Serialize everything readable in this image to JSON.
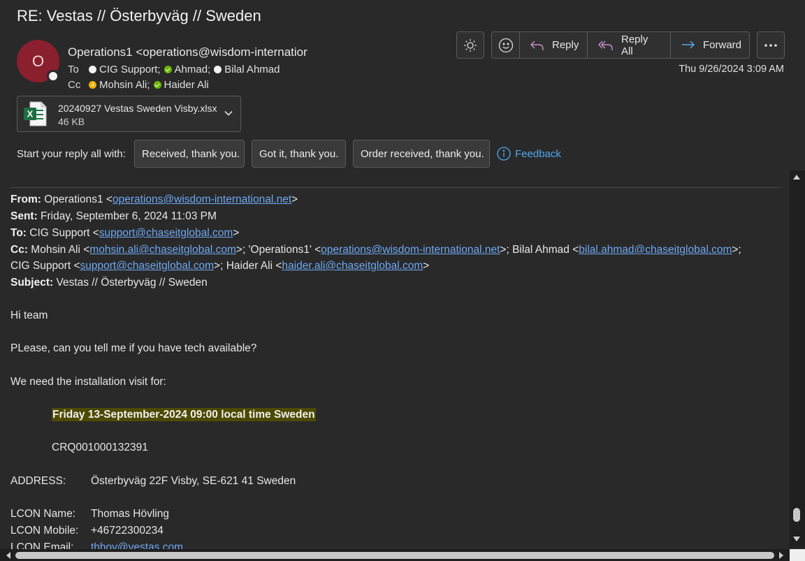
{
  "email": {
    "subject": "RE: Vestas // Österbyväg // Sweden",
    "avatar_initial": "O",
    "sender": "Operations1 <operations@wisdom-internatior",
    "to_label": "To",
    "to": [
      "CIG Support;",
      "Ahmad;",
      "Bilal Ahmad"
    ],
    "cc_label": "Cc",
    "cc": [
      "Mohsin Ali;",
      "Haider Ali"
    ],
    "date": "Thu 9/26/2024 3:09 AM"
  },
  "toolbar": {
    "reply": "Reply",
    "reply_all": "Reply All",
    "forward": "Forward"
  },
  "attachment": {
    "name": "20240927 Vestas Sweden Visby.xlsx",
    "size": "46 KB",
    "icon_letter": "X"
  },
  "quick_replies": {
    "label": "Start your reply all with:",
    "options": [
      "Received, thank you.",
      "Got it, thank you.",
      "Order received, thank you."
    ],
    "feedback": "Feedback"
  },
  "body": {
    "from_label": "From:",
    "from_name": " Operations1 <",
    "from_email": "operations@wisdom-international.net",
    "from_close": ">",
    "sent_label": "Sent:",
    "sent": " Friday, September 6, 2024 11:03 PM",
    "to_label": "To:",
    "to_name": " CIG Support <",
    "to_email": "support@chaseitglobal.com",
    "to_close": ">",
    "cc_label": "Cc:",
    "cc_1_name": " Mohsin Ali <",
    "cc_1_email": "mohsin.ali@chaseitglobal.com",
    "cc_2_name": ">; 'Operations1' <",
    "cc_2_email": "operations@wisdom-international.net",
    "cc_3_name": ">; Bilal Ahmad <",
    "cc_3_email": "bilal.ahmad@chaseitglobal.com",
    "cc_3_close": ">;",
    "cc_4_name": "CIG Support <",
    "cc_4_email": "support@chaseitglobal.com",
    "cc_5_name": ">; Haider Ali <",
    "cc_5_email": "haider.ali@chaseitglobal.com",
    "cc_5_close": ">",
    "subject_label": "Subject:",
    "subject": " Vestas // Österbyväg // Sweden",
    "greeting": "Hi team",
    "question": "PLease, can you tell me if you have tech available?",
    "need": "We need the installation visit for:",
    "visit_date": "Friday 13-September-2024 09:00 local time Sweden",
    "crq": "CRQ001000132391",
    "address_label": "ADDRESS:",
    "address": "Österbyväg 22F Visby, SE-621 41 Sweden",
    "lcon_name_label": "LCON Name:",
    "lcon_name": "Thomas Hövling",
    "lcon_mobile_label": "LCON Mobile:",
    "lcon_mobile": "+46722300234",
    "lcon_email_label": "LCON Email:",
    "lcon_email": "thhov@vestas.com"
  }
}
